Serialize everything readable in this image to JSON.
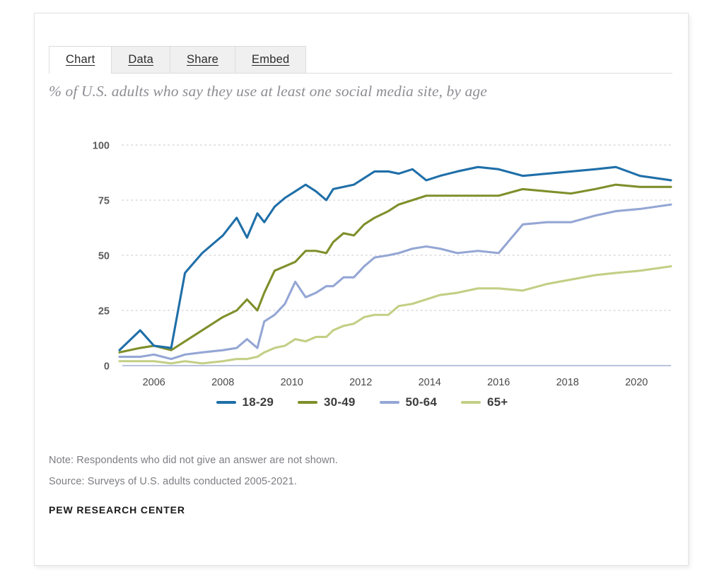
{
  "card": {
    "tabs": [
      {
        "label": "Chart",
        "active": true
      },
      {
        "label": "Data",
        "active": false
      },
      {
        "label": "Share",
        "active": false
      },
      {
        "label": "Embed",
        "active": false
      }
    ]
  },
  "footer": {
    "note": "Note: Respondents who did not give an answer are not shown.",
    "source": "Source: Surveys of U.S. adults conducted 2005-2021.",
    "brand": "PEW RESEARCH CENTER"
  },
  "colors": {
    "series_18_29": "#1f6fa8",
    "series_30_49": "#7f8f2b",
    "series_50_64": "#94a6d4",
    "series_65_plus": "#c3cf85",
    "gridline": "#d8d8de",
    "axis": "#b9c3dd",
    "title": "#8d8d93"
  },
  "chart_data": {
    "type": "line",
    "title": "% of U.S. adults who say they use at least one social media site, by age",
    "xlabel": "",
    "ylabel": "",
    "xlim": [
      2005,
      2021
    ],
    "ylim": [
      0,
      100
    ],
    "yticks": [
      0,
      25,
      50,
      75,
      100
    ],
    "xticks": [
      2006,
      2008,
      2010,
      2012,
      2014,
      2016,
      2018,
      2020
    ],
    "grid": true,
    "legend_position": "bottom",
    "x": [
      2005.0,
      2005.6,
      2006.0,
      2006.5,
      2006.9,
      2007.4,
      2008.0,
      2008.4,
      2008.7,
      2009.0,
      2009.2,
      2009.5,
      2009.8,
      2010.1,
      2010.4,
      2010.7,
      2011.0,
      2011.2,
      2011.5,
      2011.8,
      2012.1,
      2012.4,
      2012.8,
      2013.1,
      2013.5,
      2013.9,
      2014.3,
      2014.8,
      2015.4,
      2016.0,
      2016.7,
      2017.4,
      2018.1,
      2018.8,
      2019.4,
      2020.1,
      2021.0
    ],
    "series": [
      {
        "name": "18-29",
        "color": "#1f6fa8",
        "values": [
          7,
          16,
          9,
          8,
          42,
          51,
          59,
          67,
          58,
          69,
          65,
          72,
          76,
          79,
          82,
          79,
          75,
          80,
          81,
          82,
          85,
          88,
          88,
          87,
          89,
          84,
          86,
          88,
          90,
          89,
          86,
          87,
          88,
          89,
          90,
          86,
          84
        ]
      },
      {
        "name": "30-49",
        "color": "#7f8f2b",
        "values": [
          6,
          8,
          9,
          7,
          11,
          16,
          22,
          25,
          30,
          25,
          33,
          43,
          45,
          47,
          52,
          52,
          51,
          56,
          60,
          59,
          64,
          67,
          70,
          73,
          75,
          77,
          77,
          77,
          77,
          77,
          80,
          79,
          78,
          80,
          82,
          81,
          81
        ]
      },
      {
        "name": "50-64",
        "color": "#94a6d4",
        "values": [
          4,
          4,
          5,
          3,
          5,
          6,
          7,
          8,
          12,
          8,
          20,
          23,
          28,
          38,
          31,
          33,
          36,
          36,
          40,
          40,
          45,
          49,
          50,
          51,
          53,
          54,
          53,
          51,
          52,
          51,
          64,
          65,
          65,
          68,
          70,
          71,
          73
        ]
      },
      {
        "name": "65+",
        "color": "#c3cf85",
        "values": [
          2,
          2,
          2,
          1,
          2,
          1,
          2,
          3,
          3,
          4,
          6,
          8,
          9,
          12,
          11,
          13,
          13,
          16,
          18,
          19,
          22,
          23,
          23,
          27,
          28,
          30,
          32,
          33,
          35,
          35,
          34,
          37,
          39,
          41,
          42,
          43,
          45
        ]
      }
    ]
  }
}
